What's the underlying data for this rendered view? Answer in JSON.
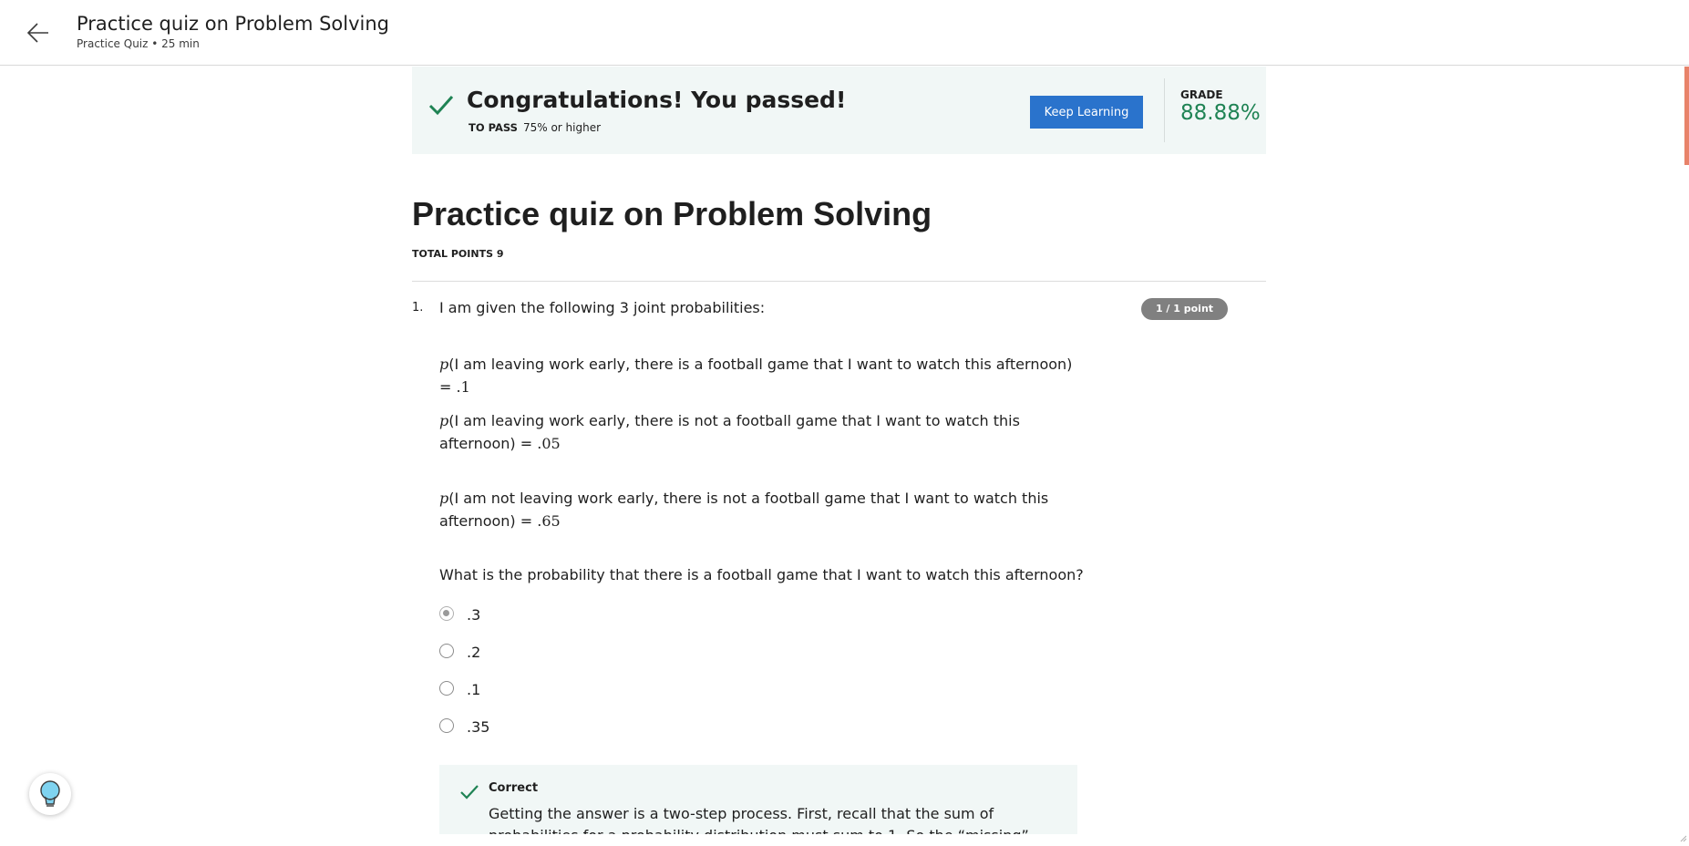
{
  "header": {
    "title": "Practice quiz on Problem Solving",
    "subtitle": "Practice Quiz • 25 min"
  },
  "banner": {
    "message": "Congratulations! You passed!",
    "to_pass_label": "TO PASS",
    "to_pass_value": "75% or higher",
    "keep_learning_label": "Keep Learning",
    "grade_label": "GRADE",
    "grade_value": "88.88%"
  },
  "quiz": {
    "title": "Practice quiz on Problem Solving",
    "total_points": "TOTAL POINTS 9"
  },
  "question1": {
    "number": "1.",
    "intro": "I am given the following 3 joint probabilities:",
    "points": "1 / 1 point",
    "probabilities": [
      {
        "p": "p",
        "text": "(I am leaving work early, there is a football game that I want to watch this afternoon) = ",
        "value": ".1"
      },
      {
        "p": "p",
        "text": "(I am leaving work early, there is not a football game that I want to watch this afternoon) = ",
        "value": ".05"
      },
      {
        "p": "p",
        "text": "(I am not leaving work early, there is not a football game that I want to watch this afternoon) = ",
        "value": ".65"
      }
    ],
    "question": "What is the probability that there is a football game that I want to watch this afternoon?",
    "options": [
      ".3",
      ".2",
      ".1",
      ".35"
    ],
    "selected_index": 0,
    "feedback": {
      "title": "Correct",
      "text": "Getting the answer is a two-step process. First, recall that the sum of probabilities for a probability distribution must sum to 1. So the “missing” joint distribution"
    }
  },
  "colors": {
    "accent_blue": "#2a73cc",
    "success_green": "#1f8354",
    "banner_bg": "#f1f7f6",
    "badge_gray": "#808080"
  },
  "icons": {
    "back": "arrow-left-icon",
    "check": "check-icon",
    "hint": "lightbulb-icon"
  }
}
